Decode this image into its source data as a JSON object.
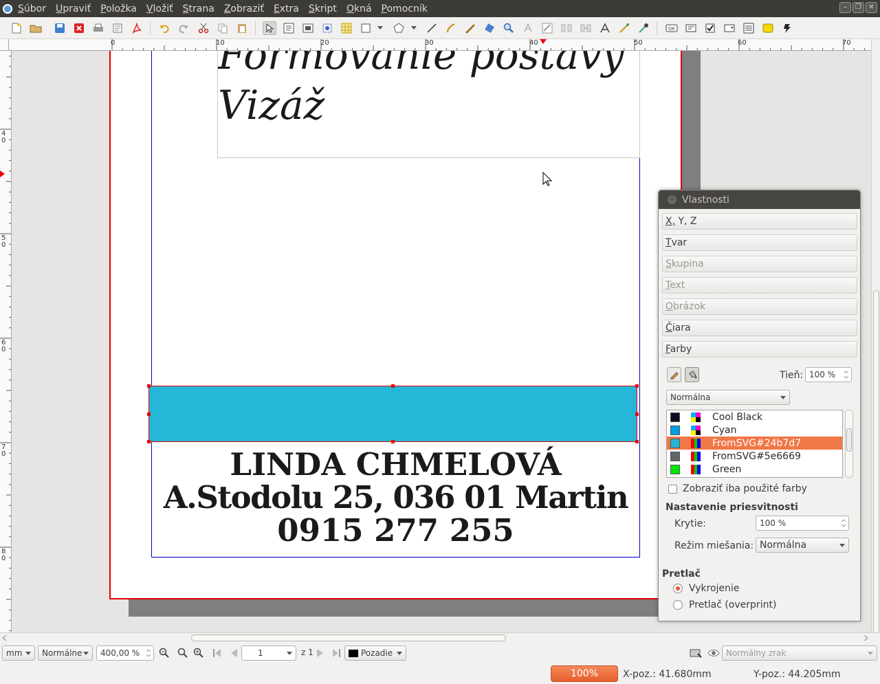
{
  "menubar": {
    "items": [
      "Súbor",
      "Upraviť",
      "Položka",
      "Vložiť",
      "Strana",
      "Zobraziť",
      "Extra",
      "Skript",
      "Okná",
      "Pomocník"
    ]
  },
  "ruler": {
    "h_labels": [
      "0",
      "10",
      "20",
      "30",
      "40",
      "50",
      "60",
      "70"
    ],
    "v_labels": [
      "4\n0",
      "5\n0",
      "6\n0",
      "7\n0",
      "8\n0"
    ]
  },
  "document": {
    "headline_1": "Formovanie postavy",
    "headline_2": "Vizáž",
    "band_color": "#24b7d7",
    "name": "LINDA CHMELOVÁ",
    "address": "A.Stodolu 25, 036 01 Martin",
    "phone": "0915 277 255"
  },
  "properties_panel": {
    "title": "Vlastnosti",
    "sections": [
      {
        "label": "X, Y, Z",
        "enabled": true
      },
      {
        "label": "Tvar",
        "enabled": true
      },
      {
        "label": "Skupina",
        "enabled": false
      },
      {
        "label": "Text",
        "enabled": false
      },
      {
        "label": "Obrázok",
        "enabled": false
      },
      {
        "label": "Čiara",
        "enabled": true
      },
      {
        "label": "Farby",
        "enabled": true
      }
    ],
    "shade_label": "Tieň:",
    "shade_value": "100 %",
    "gradient_mode": "Normálna",
    "colors": [
      {
        "name": "Cool Black",
        "swatch": "#0b1020",
        "selected": false
      },
      {
        "name": "Cyan",
        "swatch": "#009fe3",
        "selected": false
      },
      {
        "name": "FromSVG#24b7d7",
        "swatch": "#24b7d7",
        "selected": true
      },
      {
        "name": "FromSVG#5e6669",
        "swatch": "#5e6669",
        "selected": false
      },
      {
        "name": "Green",
        "swatch": "#00e600",
        "selected": false
      }
    ],
    "show_used_label": "Zobraziť iba použité farby",
    "transparency_heading": "Nastavenie priesvitnosti",
    "opacity_label": "Krytie:",
    "opacity_value": "100 %",
    "blend_label": "Režim miešania:",
    "blend_value": "Normálna",
    "overprint_heading": "Pretlač",
    "knockout_label": "Vykrojenie",
    "overprint_label": "Pretlač (overprint)"
  },
  "statusbar": {
    "unit": "mm",
    "quality": "Normálne",
    "zoom": "400,00 %",
    "page": "1",
    "page_of": "z 1",
    "layer": "Pozadie",
    "view_mode": "Normálny zrak"
  },
  "bottombar": {
    "progress": "100%",
    "x_pos": "X-poz.: 41.680mm",
    "y_pos": "Y-poz.: 44.205mm"
  },
  "colors": {
    "menubar_bg": "#3c3b37",
    "accent": "#f07746",
    "page_border": "#e00000",
    "margin_guide": "#0000c8"
  }
}
